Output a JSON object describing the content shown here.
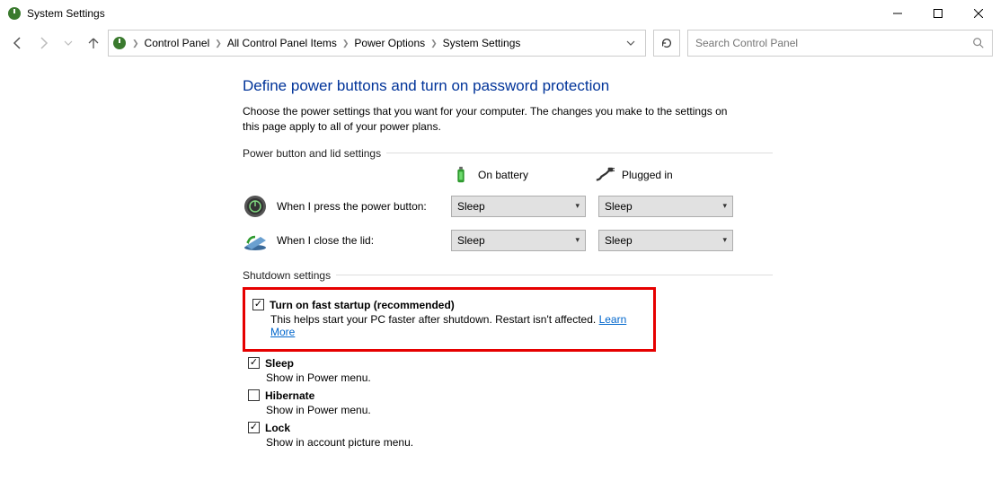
{
  "window": {
    "title": "System Settings"
  },
  "breadcrumbs": [
    "Control Panel",
    "All Control Panel Items",
    "Power Options",
    "System Settings"
  ],
  "search": {
    "placeholder": "Search Control Panel"
  },
  "page": {
    "heading": "Define power buttons and turn on password protection",
    "description": "Choose the power settings that you want for your computer. The changes you make to the settings on this page apply to all of your power plans.",
    "section1_label": "Power button and lid settings",
    "col_battery": "On battery",
    "col_plugged": "Plugged in",
    "row_power_label": "When I press the power button:",
    "row_lid_label": "When I close the lid:",
    "power_battery_value": "Sleep",
    "power_plugged_value": "Sleep",
    "lid_battery_value": "Sleep",
    "lid_plugged_value": "Sleep",
    "section2_label": "Shutdown settings",
    "fast_startup": {
      "name": "Turn on fast startup (recommended)",
      "sub_prefix": "This helps start your PC faster after shutdown. Restart isn't affected. ",
      "link": "Learn More"
    },
    "sleep": {
      "name": "Sleep",
      "sub": "Show in Power menu."
    },
    "hibernate": {
      "name": "Hibernate",
      "sub": "Show in Power menu."
    },
    "lock": {
      "name": "Lock",
      "sub": "Show in account picture menu."
    }
  }
}
